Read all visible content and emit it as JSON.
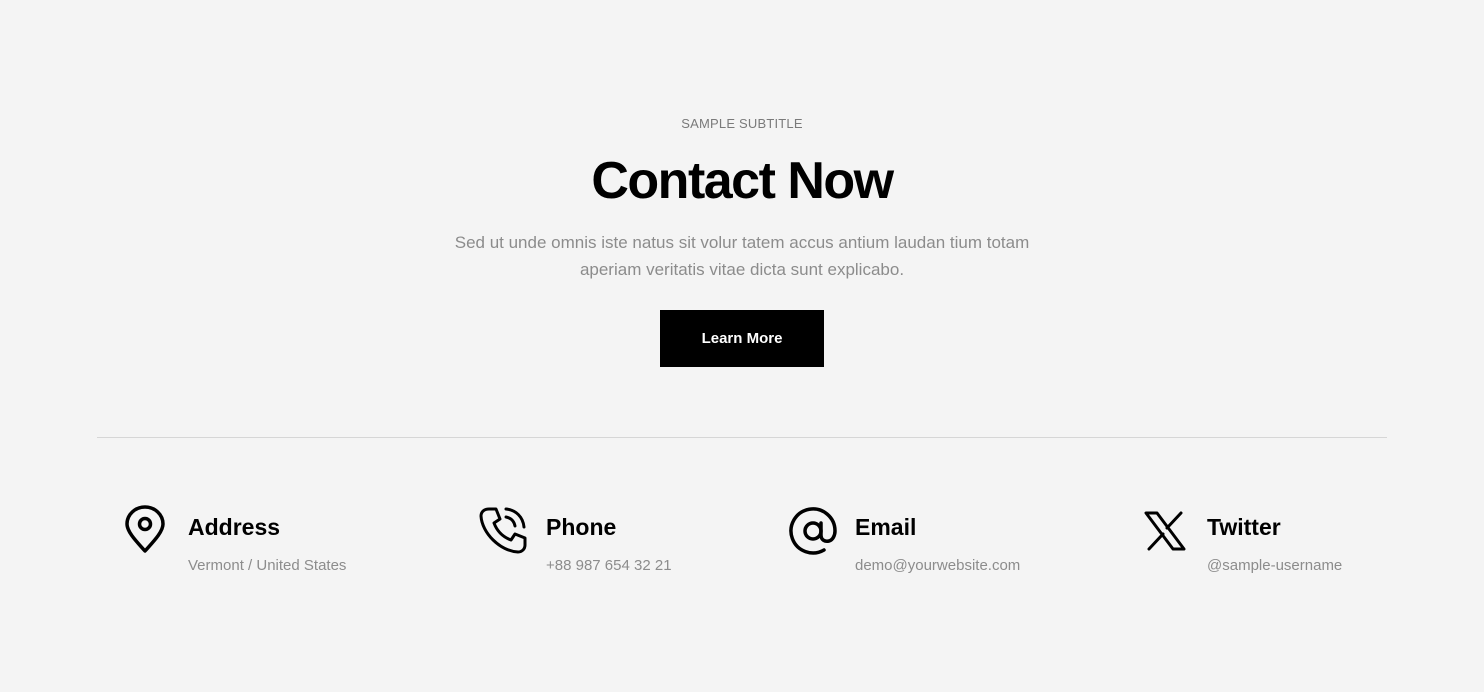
{
  "hero": {
    "subtitle": "SAMPLE SUBTITLE",
    "title": "Contact Now",
    "description": "Sed ut unde omnis iste natus sit volur tatem accus antium laudan tium totam aperiam veritatis vitae dicta sunt explicabo.",
    "button_label": "Learn More"
  },
  "contact": {
    "items": [
      {
        "icon": "map-pin-icon",
        "label": "Address",
        "value": "Vermont / United States"
      },
      {
        "icon": "phone-icon",
        "label": "Phone",
        "value": "+88 987 654 32 21"
      },
      {
        "icon": "at-sign-icon",
        "label": "Email",
        "value": "demo@yourwebsite.com"
      },
      {
        "icon": "x-twitter-icon",
        "label": "Twitter",
        "value": "@sample-username"
      }
    ]
  },
  "colors": {
    "background": "#f4f4f4",
    "text": "#000000",
    "muted": "#8c8c8c",
    "button_bg": "#000000",
    "button_text": "#ffffff",
    "divider": "#d6d6d6"
  }
}
